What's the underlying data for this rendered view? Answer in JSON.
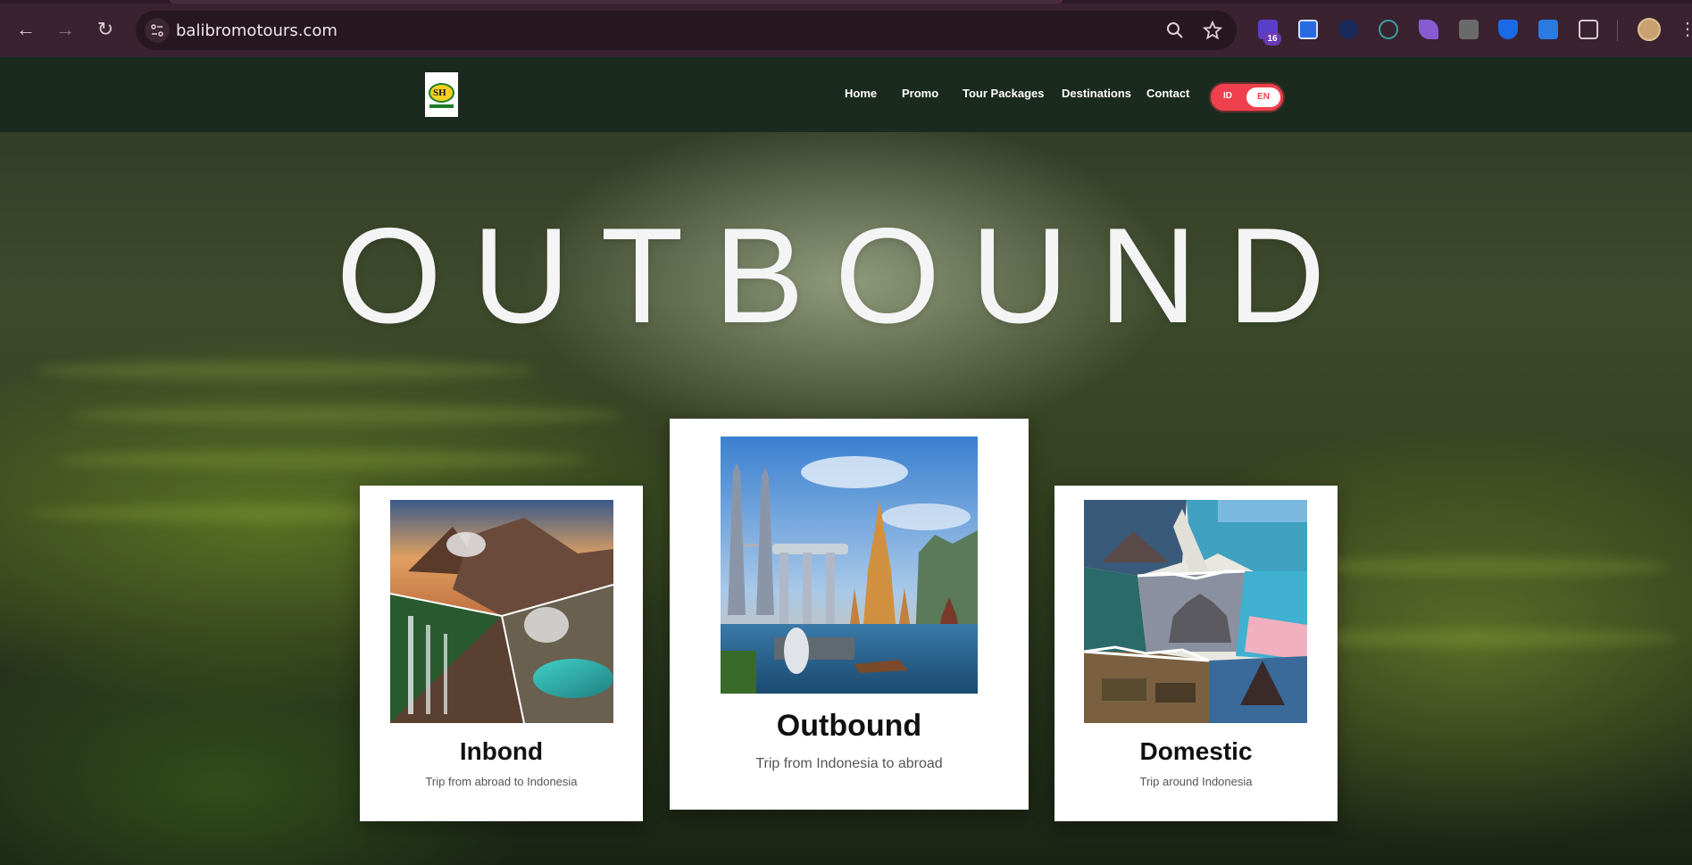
{
  "browser": {
    "url": "balibromotours.com",
    "extension_badge": "16"
  },
  "nav": {
    "items": [
      "Home",
      "Promo",
      "Tour Packages",
      "Destinations",
      "Contact"
    ],
    "lang": {
      "id": "ID",
      "en": "EN",
      "selected": "EN"
    }
  },
  "logo_text": "SH",
  "hero": {
    "title": "OUTBOUND"
  },
  "cards": [
    {
      "title": "Inbond",
      "subtitle": "Trip from abroad to Indonesia",
      "image": "bromo-volcano-waterfall-crater-collage"
    },
    {
      "title": "Outbound",
      "subtitle": "Trip from Indonesia to abroad",
      "image": "petronas-marina-bay-temple-collage"
    },
    {
      "title": "Domestic",
      "subtitle": "Trip around Indonesia",
      "image": "indonesia-destinations-collage"
    }
  ],
  "colors": {
    "navbar": "#1b2a1e",
    "toggle": "#f0404d",
    "chrome": "#3a2230"
  }
}
